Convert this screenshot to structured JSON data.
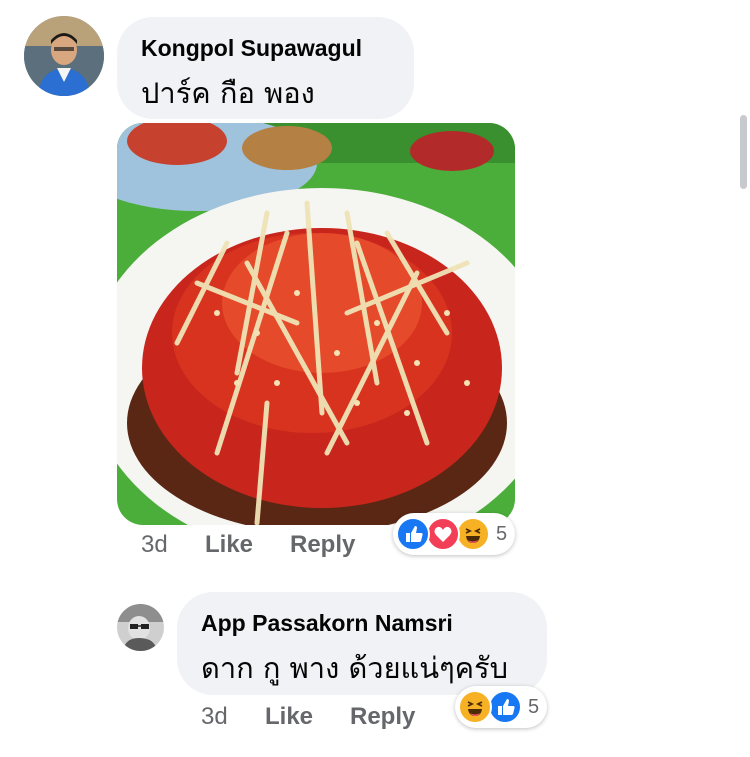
{
  "comments": [
    {
      "author": "Kongpol Supawagul",
      "text": "ปาร์ค กือ พอง",
      "time": "3d",
      "like_label": "Like",
      "reply_label": "Reply",
      "reactions": [
        "like-icon",
        "love-icon",
        "haha-icon"
      ],
      "reaction_count": "5",
      "has_photo": true
    },
    {
      "author": "App Passakorn Namsri",
      "text": "ดาก กู พาง ด้วยแน่ๆครับ",
      "time": "3d",
      "like_label": "Like",
      "reply_label": "Reply",
      "reactions": [
        "haha-icon",
        "like-icon"
      ],
      "reaction_count": "5"
    }
  ],
  "colors": {
    "bubble": "#f0f2f5",
    "meta_text": "#65676b",
    "like_blue": "#1877f2",
    "love_red": "#f33e58",
    "haha_yellow": "#f7b125"
  }
}
